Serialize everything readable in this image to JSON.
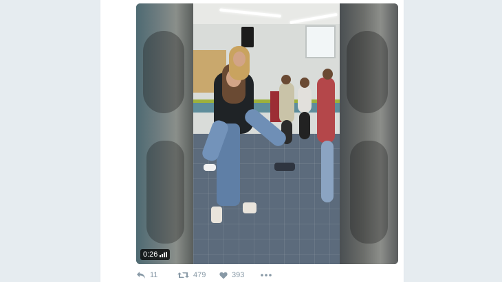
{
  "video": {
    "duration": "0:26",
    "accent_color": "#ffffff"
  },
  "actions": {
    "reply_count": "11",
    "retweet_count": "479",
    "like_count": "393"
  },
  "icons": [
    "reply-icon",
    "retweet-icon",
    "heart-icon",
    "more-icon",
    "volume-bars-icon"
  ],
  "colors": {
    "page_background": "#e6ecf0",
    "icon_gray": "#8899a6"
  }
}
